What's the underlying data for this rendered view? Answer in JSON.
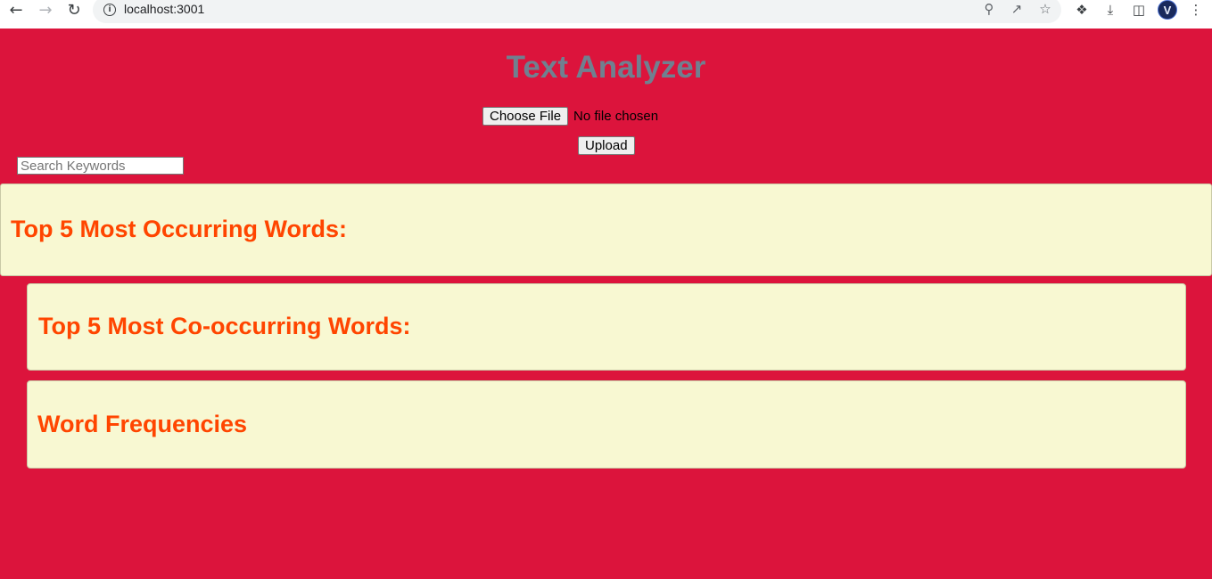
{
  "browser": {
    "url": "localhost:3001",
    "back_icon": "arrow-left-icon",
    "forward_icon": "arrow-right-icon",
    "reload_icon": "reload-icon",
    "profile_initial": "V"
  },
  "header": {
    "title": "Text Analyzer"
  },
  "upload": {
    "choose_file_label": "Choose File",
    "file_status": "No file chosen",
    "upload_label": "Upload"
  },
  "search": {
    "placeholder": "Search Keywords",
    "value": ""
  },
  "sections": {
    "top_words_heading": "Top 5 Most Occurring Words:",
    "co_occurring_heading": "Top 5 Most Co-occurring Words:",
    "word_frequencies_heading": "Word Frequencies"
  },
  "colors": {
    "page_background": "#dc143c",
    "title": "#708090",
    "panel_background": "#f8f8d2",
    "heading": "#ff4500"
  }
}
